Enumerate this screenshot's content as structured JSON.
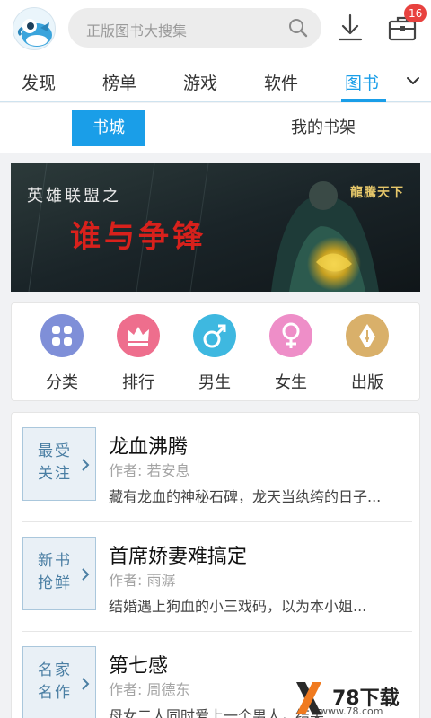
{
  "header": {
    "search_placeholder": "正版图书大搜集",
    "notification_count": "16"
  },
  "nav_tabs": [
    {
      "label": "发现"
    },
    {
      "label": "榜单"
    },
    {
      "label": "游戏"
    },
    {
      "label": "软件"
    },
    {
      "label": "图书",
      "active": true
    }
  ],
  "segment": {
    "store": "书城",
    "shelf": "我的书架"
  },
  "banner": {
    "subtitle": "英雄联盟之",
    "title": "谁与争锋",
    "logo_text": "龍騰天下"
  },
  "categories": [
    {
      "label": "分类",
      "icon": "grid-icon",
      "color": "#7f8fd8"
    },
    {
      "label": "排行",
      "icon": "crown-icon",
      "color": "#ee6e8d"
    },
    {
      "label": "男生",
      "icon": "male-icon",
      "color": "#3eb8e0"
    },
    {
      "label": "女生",
      "icon": "female-icon",
      "color": "#ee8ec8"
    },
    {
      "label": "出版",
      "icon": "pen-nib-icon",
      "color": "#d9b06a"
    }
  ],
  "books": [
    {
      "tag": "最受关注",
      "title": "龙血沸腾",
      "author": "作者: 若安息",
      "desc": "藏有龙血的神秘石碑，龙天当纨绔的日子..."
    },
    {
      "tag": "新书抢鲜",
      "title": "首席娇妻难搞定",
      "author": "作者: 雨潺",
      "desc": "结婚遇上狗血的小三戏码，以为本小姐..."
    },
    {
      "tag": "名家名作",
      "title": "第七感",
      "author": "作者: 周德东",
      "desc": "母女二人同时爱上一个男人，结果..."
    }
  ],
  "watermark": {
    "brand": "78下载",
    "url": "www.78.com"
  },
  "colors": {
    "accent": "#1a9ee8",
    "badge": "#e8423f"
  }
}
